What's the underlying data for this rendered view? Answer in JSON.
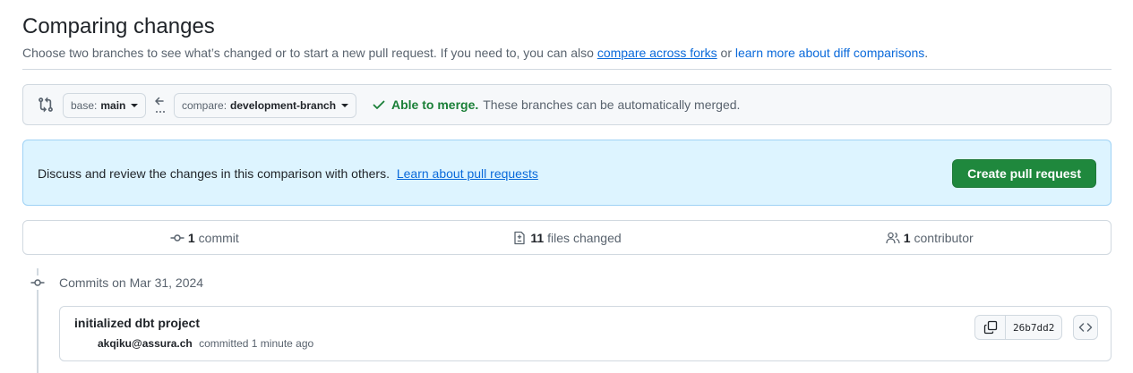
{
  "header": {
    "title": "Comparing changes",
    "subtitle_prefix": "Choose two branches to see what’s changed or to start a new pull request. If you need to, you can also",
    "compare_forks_link": "compare across forks",
    "or_text": "or",
    "learn_more_link": "learn more about diff comparisons",
    "period": "."
  },
  "range": {
    "base_prefix": "base:",
    "base_value": "main",
    "compare_prefix": "compare:",
    "compare_value": "development-branch",
    "merge_ok": "Able to merge.",
    "merge_detail": "These branches can be automatically merged."
  },
  "banner": {
    "text": "Discuss and review the changes in this comparison with others.",
    "link": "Learn about pull requests",
    "button": "Create pull request"
  },
  "stats": {
    "commits_count": "1",
    "commits_label": "commit",
    "files_count": "11",
    "files_label": "files changed",
    "contributors_count": "1",
    "contributors_label": "contributor"
  },
  "commits": {
    "heading": "Commits on Mar 31, 2024",
    "items": [
      {
        "title": "initialized dbt project",
        "author": "akqiku@assura.ch",
        "action": "committed",
        "time": "1 minute ago",
        "sha": "26b7dd2"
      }
    ]
  },
  "colors": {
    "link": "#0969da",
    "success": "#1a7f37",
    "primary_button": "#1f883d",
    "banner_bg": "#ddf4ff"
  },
  "icons": [
    "git-compare-icon",
    "arrow-left-icon",
    "check-icon",
    "git-commit-icon",
    "file-diff-icon",
    "people-icon",
    "copy-icon",
    "code-icon"
  ]
}
